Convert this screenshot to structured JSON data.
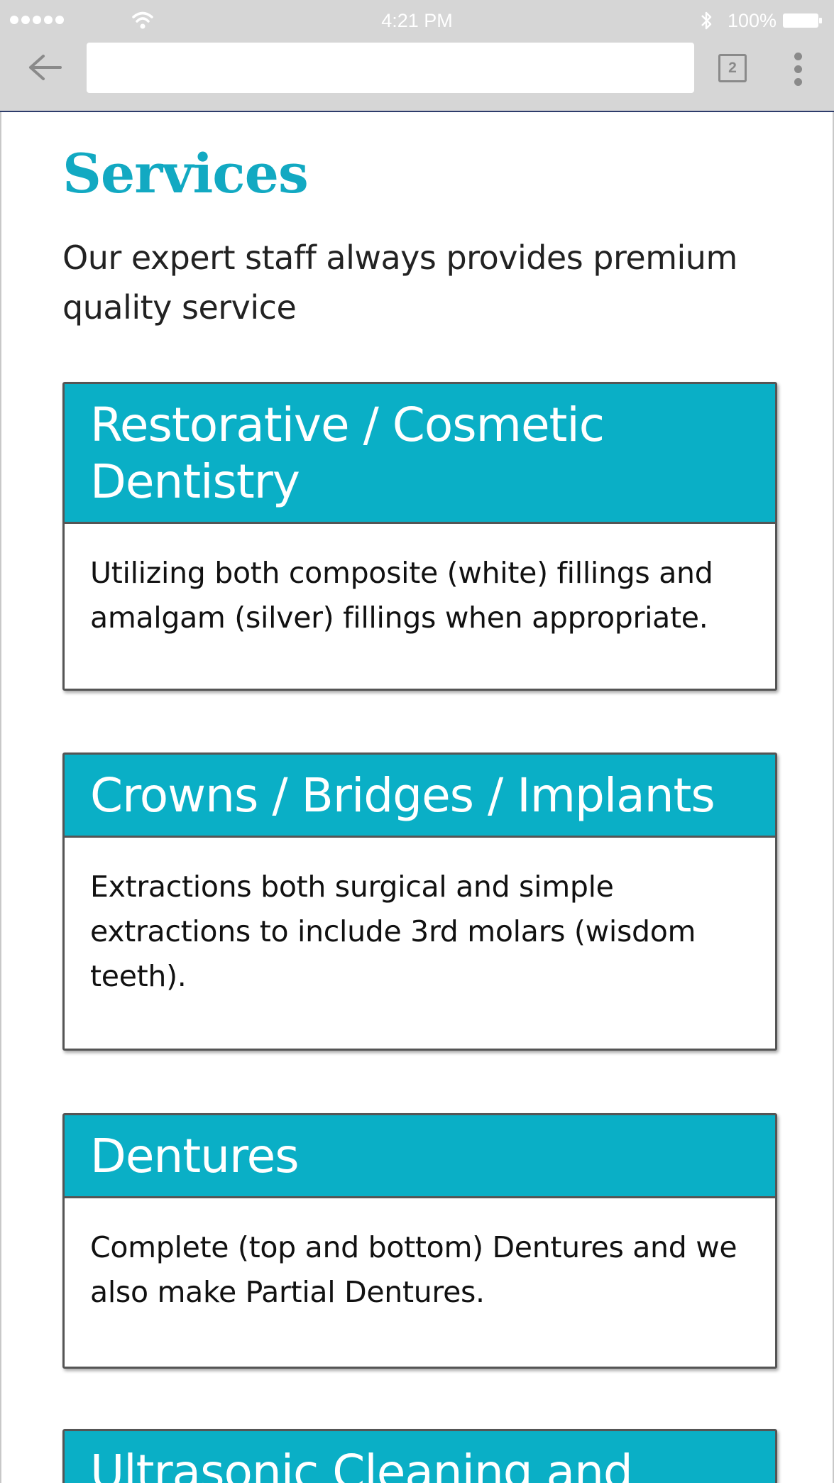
{
  "status_bar": {
    "time": "4:21 PM",
    "battery": "100%",
    "signal_icon": "signal-dots-icon",
    "wifi_icon": "wifi-icon",
    "bluetooth_icon": "bluetooth-icon",
    "battery_icon": "battery-icon"
  },
  "browser": {
    "back_icon": "back-arrow-icon",
    "url_value": "",
    "tab_count": "2",
    "menu_icon": "more-vert-icon"
  },
  "page": {
    "title": "Services",
    "subtitle": "Our expert staff always provides premium quality service"
  },
  "services": [
    {
      "title": "Restorative / Cosmetic Dentistry",
      "description": "Utilizing both composite (white) fillings and amalgam (silver) fillings when appropriate."
    },
    {
      "title": "Crowns / Bridges / Implants",
      "description": "Extractions both surgical and simple extractions to include 3rd molars (wisdom teeth)."
    },
    {
      "title": "Dentures",
      "description": "Complete (top and bottom) Dentures and we also make Partial Dentures."
    },
    {
      "title": "Ultrasonic Cleaning and"
    }
  ],
  "colors": {
    "accent": "#0aafc6",
    "title": "#12a9c2",
    "chrome": "#d6d6d6"
  }
}
